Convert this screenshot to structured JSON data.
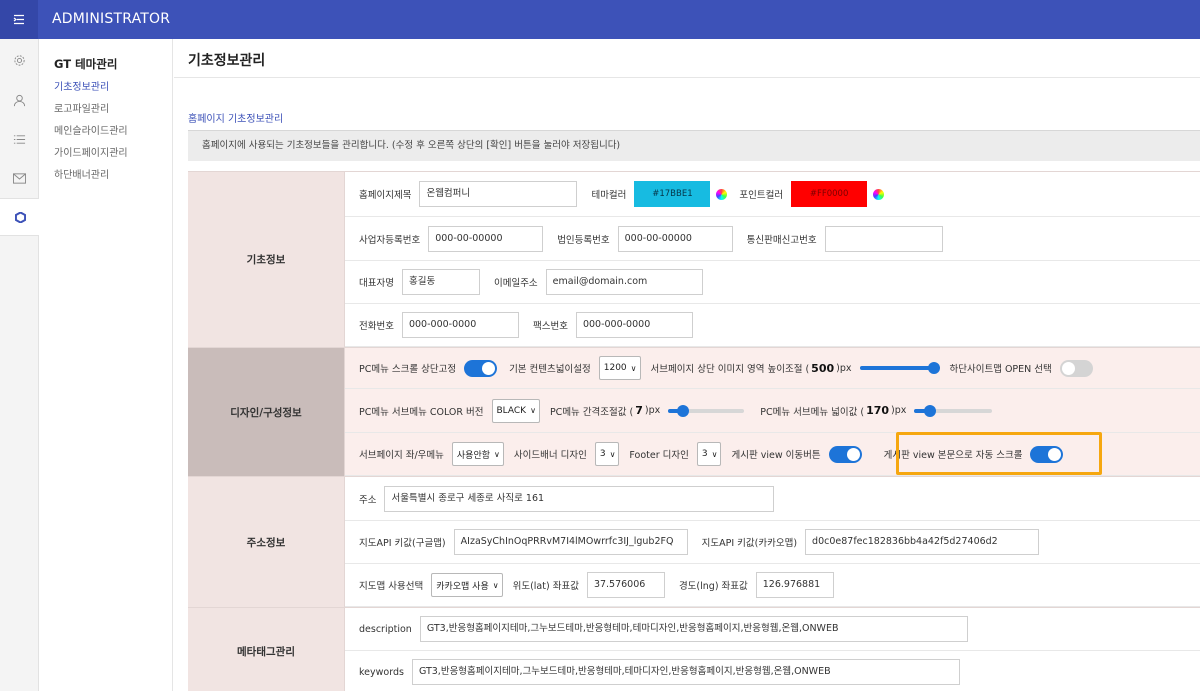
{
  "header": {
    "menu_icon": "menu-icon",
    "brand": "ADMINISTRATOR"
  },
  "iconbar": {
    "icons": [
      "gear-icon",
      "user-icon",
      "list-icon",
      "mail-icon",
      "theme-icon"
    ]
  },
  "subnav": {
    "title": "GT 테마관리",
    "items": [
      "기초정보관리",
      "로고파일관리",
      "메인슬라이드관리",
      "가이드페이지관리",
      "하단배너관리"
    ],
    "active_index": 0
  },
  "page": {
    "title": "기초정보관리",
    "section_title": "홈페이지 기초정보관리",
    "notice": "홈페이지에 사용되는 기초정보들을 관리합니다. (수정 후 오른쪽 상단의 [확인] 버튼을 눌러야 저장됩니다)"
  },
  "basic": {
    "label": "기초정보",
    "site_title_label": "홈페이지제목",
    "site_title": "온웹컴퍼니",
    "theme_color_label": "테마컬러",
    "theme_color": "#17BBE1",
    "point_color_label": "포인트컬러",
    "point_color": "#FF0000",
    "biz_no_label": "사업자등록번호",
    "biz_no": "000-00-00000",
    "corp_no_label": "법인등록번호",
    "corp_no": "000-00-00000",
    "mail_order_label": "통신판매신고번호",
    "mail_order": "",
    "ceo_label": "대표자명",
    "ceo": "홍길동",
    "email_label": "이메일주소",
    "email": "email@domain.com",
    "phone_label": "전화번호",
    "phone": "000-000-0000",
    "fax_label": "팩스번호",
    "fax": "000-000-0000"
  },
  "design": {
    "label": "디자인/구성정보",
    "pc_menu_fixed_label": "PC메뉴 스크롤 상단고정",
    "pc_menu_fixed": true,
    "content_width_label": "기본 컨텐츠넓이설정",
    "content_width": "1200",
    "sub_img_height_label_pre": "서브페이지 상단 이미지 영역 높이조절 (",
    "sub_img_height": "500",
    "sub_img_height_unit": ")px",
    "sub_img_height_level": 0.95,
    "footer_sitemap_label": "하단사이트맵 OPEN 선택",
    "footer_sitemap": false,
    "submenu_color_label": "PC메뉴 서브메뉴 COLOR 버전",
    "submenu_color": "BLACK",
    "menu_gap_label_pre": "PC메뉴 간격조절값 (",
    "menu_gap": "7",
    "menu_gap_unit": ")px",
    "menu_gap_level": 0.2,
    "submenu_width_label_pre": "PC메뉴 서브메뉴 넓이값 (",
    "submenu_width": "170",
    "submenu_width_unit": ")px",
    "submenu_width_level": 0.2,
    "sub_lr_menu_label": "서브페이지 좌/우메뉴",
    "sub_lr_menu": "사용안함",
    "side_banner_label": "사이드배너 디자인",
    "side_banner": "3",
    "footer_design_label": "Footer 디자인",
    "footer_design": "3",
    "board_view_btn_label": "게시판 view 이동버튼",
    "board_view_btn": true,
    "board_autoscroll_label": "게시판 view 본문으로 자동 스크롤",
    "board_autoscroll": true
  },
  "address": {
    "label": "주소정보",
    "addr_label": "주소",
    "addr": "서울특별시 종로구 세종로 사직로 161",
    "google_key_label": "지도API 키값(구글맵)",
    "google_key": "AIzaSyChInOqPRRvM7I4lMOwrrfc3IJ_lgub2FQ",
    "kakao_key_label": "지도API 키값(카카오맵)",
    "kakao_key": "d0c0e87fec182836bb4a42f5d27406d2",
    "map_select_label": "지도맵 사용선택",
    "map_select": "카카오맵 사용",
    "lat_label": "위도(lat) 좌표값",
    "lat": "37.576006",
    "lng_label": "경도(lng) 좌표값",
    "lng": "126.976881"
  },
  "meta": {
    "label": "메타태그관리",
    "desc_label": "description",
    "desc": "GT3,반응형홈페이지테마,그누보드테마,반응형테마,테마디자인,반응형홈페이지,반응형웹,온웹,ONWEB",
    "kw_label": "keywords",
    "kw": "GT3,반응형홈페이지테마,그누보드테마,반응형테마,테마디자인,반응형홈페이지,반응형웹,온웹,ONWEB"
  }
}
